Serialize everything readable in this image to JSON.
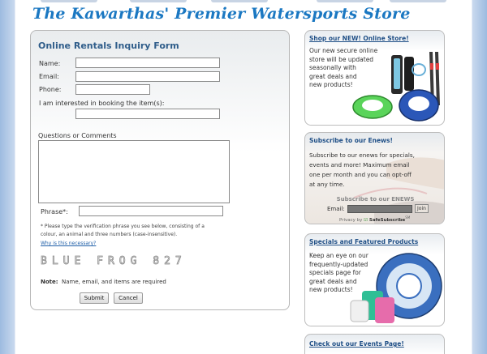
{
  "header": {
    "banner": "The Kawarthas' Premier Watersports Store"
  },
  "form": {
    "title": "Online Rentals Inquiry Form",
    "name_label": "Name:",
    "email_label": "Email:",
    "phone_label": "Phone:",
    "items_label": "I am interested in booking the item(s):",
    "comments_label": "Questions or Comments",
    "phrase_label": "Phrase*:",
    "phrase_note_1": "* Please type the verification phrase you see below, consisting of a",
    "phrase_note_2": "colour, an animal and three numbers (case-insensitive).",
    "why_link": "Why is this necessary?",
    "captcha": "BLUE FROG 827",
    "note_bold": "Note:",
    "note_text": "Name, email, and items are required",
    "submit": "Submit",
    "cancel": "Cancel"
  },
  "sidebar": {
    "shop": {
      "title": "Shop our NEW! Online Store!",
      "text": [
        "Our new secure online",
        "store will be updated",
        "seasonally with",
        "great deals and",
        "new products!"
      ]
    },
    "enews": {
      "title": "Subscribe to our Enews!",
      "text": [
        "Subscribe to our enews for specials,",
        "events and more! Maximum email",
        "one per month and you can opt-off",
        "at any time."
      ],
      "widget_title": "Subscribe to our ENEWS",
      "email_label": "Email:",
      "join": "Join",
      "privacy": "Privacy by",
      "safesubscribe": "SafeSubscribe",
      "sm": "SM"
    },
    "specials": {
      "title": "Specials and Featured Products",
      "text": [
        "Keep an eye on our",
        "frequently-updated",
        "specials page for",
        "great deals and",
        "new products!"
      ]
    },
    "events": {
      "title": "Check out our Events Page!"
    }
  }
}
